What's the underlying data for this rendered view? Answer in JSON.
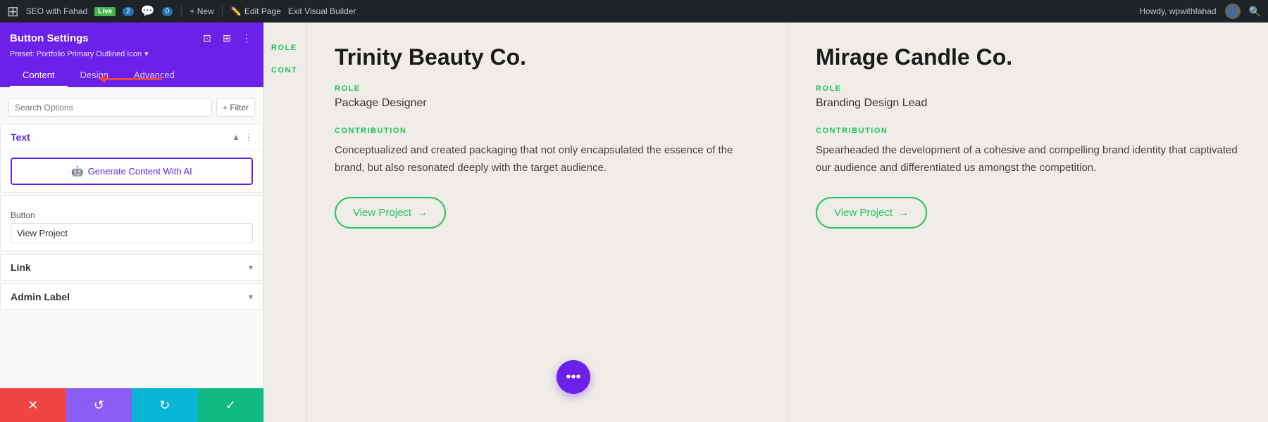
{
  "adminBar": {
    "wpLogo": "⊞",
    "siteName": "SEO with Fahad",
    "liveBadge": "Live",
    "commentCount": "2",
    "commentIcon": "💬",
    "commentBadge": "0",
    "newLabel": "+ New",
    "editLabel": "Edit Page",
    "exitLabel": "Exit Visual Builder",
    "howdy": "Howdy, wpwithfahad",
    "searchIcon": "🔍"
  },
  "panel": {
    "title": "Button Settings",
    "preset": "Preset: Portfolio Primary Outlined Icon",
    "tabs": [
      "Content",
      "Design",
      "Advanced"
    ],
    "activeTab": "Content",
    "searchPlaceholder": "Search Options",
    "filterLabel": "+ Filter",
    "sections": {
      "text": {
        "title": "Text",
        "aiButtonLabel": "Generate Content With AI",
        "aiIcon": "🤖"
      },
      "button": {
        "label": "Button",
        "value": "View Project"
      },
      "link": {
        "title": "Link"
      },
      "adminLabel": {
        "title": "Admin Label"
      }
    },
    "footer": {
      "deleteIcon": "✕",
      "undoIcon": "↺",
      "redoIcon": "↻",
      "saveIcon": "✓"
    }
  },
  "cards": [
    {
      "id": "partial",
      "partial": true
    },
    {
      "companyName": "Trinity Beauty Co.",
      "roleLabel": "ROLE",
      "roleValue": "Package Designer",
      "contributionLabel": "CONTRIBUTION",
      "contributionText": "Conceptualized and created packaging that not only encapsulated the essence of the brand, but also resonated deeply with the target audience.",
      "viewProjectLabel": "View Project",
      "viewProjectArrow": "→"
    },
    {
      "companyName": "Mirage Candle Co.",
      "roleLabel": "ROLE",
      "roleValue": "Branding Design Lead",
      "contributionLabel": "CONTRIBUTION",
      "contributionText": "Spearheaded the development of a cohesive and compelling brand identity that captivated our audience and differentiated us amongst the competition.",
      "viewProjectLabel": "View Project",
      "viewProjectArrow": "→"
    }
  ],
  "floatingBtn": {
    "icon": "•••"
  }
}
